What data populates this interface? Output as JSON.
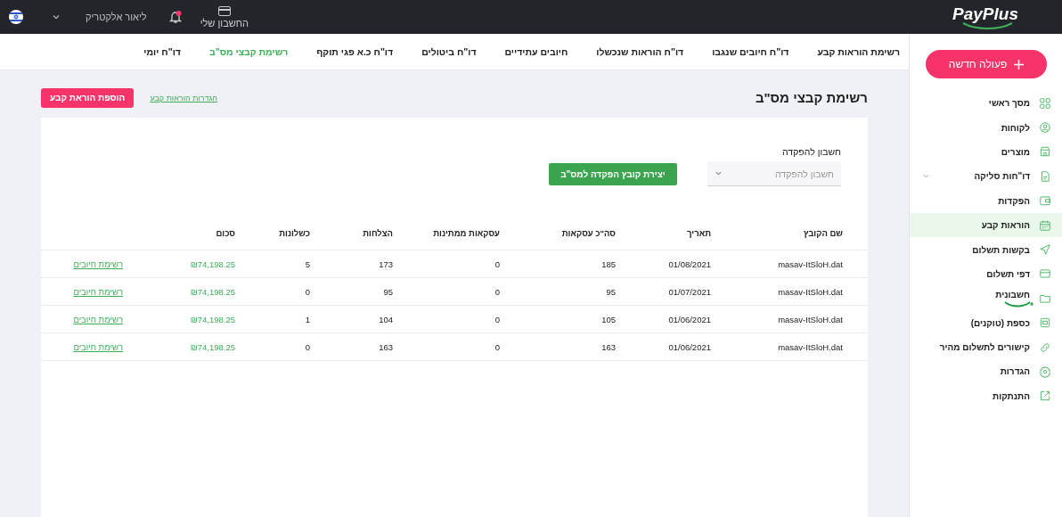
{
  "top_bar": {
    "logo": "PayPlus",
    "account": "החשבון שלי",
    "notification_unread": true,
    "user": "ליאור אלקטריק"
  },
  "sidebar": {
    "new_action": "פעולה חדשה",
    "items": [
      {
        "label": "מסך ראשי",
        "selected": false
      },
      {
        "label": "לקוחות",
        "selected": false
      },
      {
        "label": "מוצרים",
        "selected": false
      },
      {
        "label": "דו\"חות סליקה",
        "selected": false,
        "expanded": false
      },
      {
        "label": "הפקדות",
        "selected": false
      },
      {
        "label": "הוראות קבע",
        "selected": true
      },
      {
        "label": "בקשות תשלום",
        "selected": false
      },
      {
        "label": "דפי תשלום",
        "selected": false
      },
      {
        "label": "חשבונית",
        "selected": false,
        "kind": "brand"
      },
      {
        "label": "כספת (טוקנים)",
        "selected": false
      },
      {
        "label": "קישורים לתשלום מהיר",
        "selected": false
      },
      {
        "label": "הגדרות",
        "selected": false
      },
      {
        "label": "התנתקות",
        "selected": false
      }
    ]
  },
  "tabs": [
    {
      "label": "רשימת הוראות קבע",
      "selected": false
    },
    {
      "label": "דו\"ח חיובים שנגבו",
      "selected": false
    },
    {
      "label": "דו\"ח הוראות שנכשלו",
      "selected": false
    },
    {
      "label": "חיובים עתידיים",
      "selected": false
    },
    {
      "label": "דו\"ח ביטולים",
      "selected": false
    },
    {
      "label": "דו\"ח כ.א פגי תוקף",
      "selected": false
    },
    {
      "label": "רשימת קבצי מס\"ב",
      "selected": true
    },
    {
      "label": "דו\"ח יומי",
      "selected": false
    }
  ],
  "page": {
    "title": "רשימת קבצי מס\"ב",
    "settings_link": "הגדרות הוראות קבע",
    "add_button": "הוספת הוראת קבע"
  },
  "form": {
    "label": "חשבון להפקדה",
    "placeholder": "חשבון להפקדה",
    "create_button": "יצירת קובץ הפקדה למס\"ב"
  },
  "table": {
    "columns": [
      "שם הקובץ",
      "תאריך",
      "סה\"כ עסקאות",
      "עסקאות ממתינות",
      "הצלחות",
      "כשלונות",
      "סכום"
    ],
    "rows": [
      {
        "file": "masav-ItSloH.dat",
        "date": "01/08/2021",
        "total": "185",
        "pending": "0",
        "successes": "173",
        "failures": "5",
        "amount": "₪74,198.25",
        "link": "רשימת חיובים"
      },
      {
        "file": "masav-ItSloH.dat",
        "date": "01/07/2021",
        "total": "95",
        "pending": "0",
        "successes": "95",
        "failures": "0",
        "amount": "₪74,198.25",
        "link": "רשימת חיובים"
      },
      {
        "file": "masav-ItSloH.dat",
        "date": "01/06/2021",
        "total": "105",
        "pending": "0",
        "successes": "104",
        "failures": "1",
        "amount": "₪74,198.25",
        "link": "רשימת חיובים"
      },
      {
        "file": "masav-ItSloH.dat",
        "date": "01/06/2021",
        "total": "163",
        "pending": "0",
        "successes": "163",
        "failures": "0",
        "amount": "₪74,198.25",
        "link": "רשימת חיובים"
      }
    ]
  }
}
